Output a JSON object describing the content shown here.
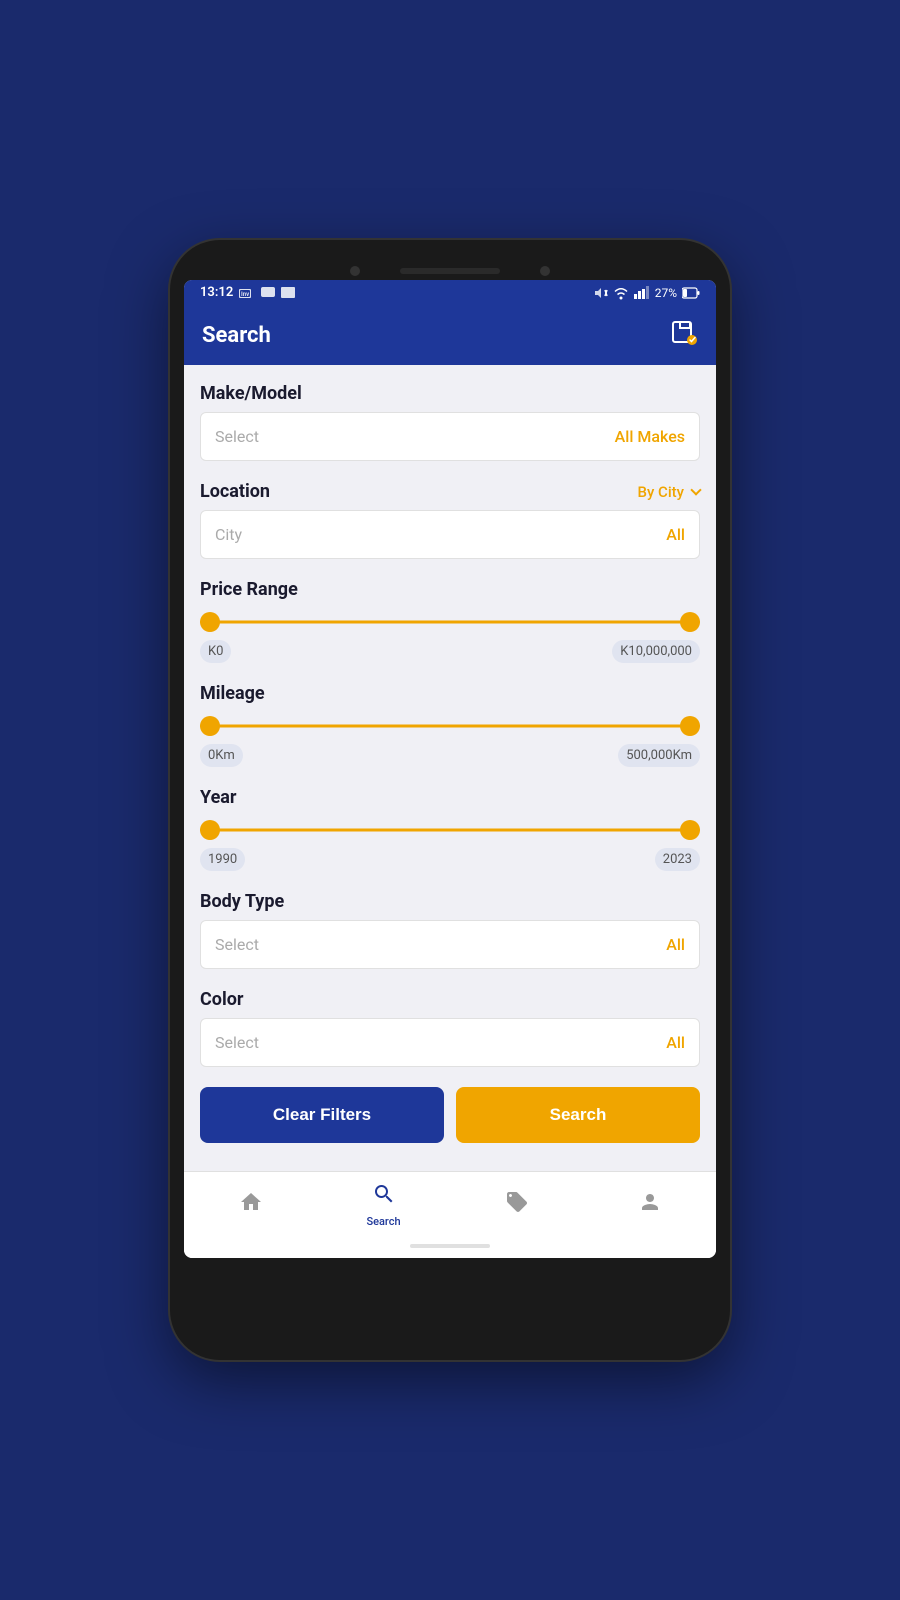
{
  "statusBar": {
    "time": "13:12",
    "battery": "27%"
  },
  "header": {
    "title": "Search",
    "saveIconLabel": "save-edit-icon"
  },
  "makeModel": {
    "sectionLabel": "Make/Model",
    "placeholder": "Select",
    "value": "All Makes"
  },
  "location": {
    "sectionLabel": "Location",
    "filterType": "By City",
    "placeholder": "City",
    "value": "All"
  },
  "priceRange": {
    "sectionLabel": "Price Range",
    "minValue": "K0",
    "maxValue": "K10,000,000"
  },
  "mileage": {
    "sectionLabel": "Mileage",
    "minValue": "0Km",
    "maxValue": "500,000Km"
  },
  "year": {
    "sectionLabel": "Year",
    "minValue": "1990",
    "maxValue": "2023"
  },
  "bodyType": {
    "sectionLabel": "Body Type",
    "placeholder": "Select",
    "value": "All"
  },
  "color": {
    "sectionLabel": "Color",
    "placeholder": "Select",
    "value": "All"
  },
  "buttons": {
    "clearFilters": "Clear Filters",
    "search": "Search"
  },
  "bottomNav": {
    "home": "Home",
    "search": "Search",
    "tags": "Tags",
    "profile": "Profile"
  }
}
